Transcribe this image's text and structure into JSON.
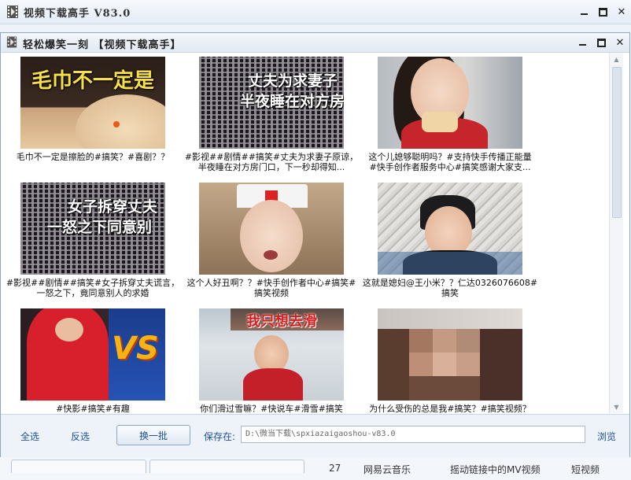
{
  "outer_window": {
    "title": "视频下载高手 V83.0",
    "list_row": {
      "num": "27",
      "col1": "网易云音乐",
      "col2": "摇动链接中的MV视频",
      "col3": "短视频"
    }
  },
  "dialog": {
    "title": "轻松爆笑一刻 【视频下载高手】",
    "videos": [
      {
        "caption_lines": [
          "毛巾不一定是擦脸的#搞笑？#喜剧？？"
        ],
        "overlay": "毛巾不一定是"
      },
      {
        "caption_lines": [
          "#影视##剧情##搞笑#丈夫为求妻子原谅，",
          "半夜睡在对方房门口，下一秒却得知..."
        ],
        "overlay_lines": [
          "丈夫为求妻子",
          "半夜睡在对方房"
        ]
      },
      {
        "caption_lines": [
          "这个儿媳够聪明吗？#支持快手传播正能量",
          "#快手创作者服务中心#搞笑感谢大家支..."
        ]
      },
      {
        "caption_lines": [
          "#影视##剧情##搞笑#女子拆穿丈夫谎言，",
          "一怒之下，竟同意别人的求婚"
        ],
        "overlay_lines": [
          "女子拆穿丈夫",
          "一怒之下同意别"
        ]
      },
      {
        "caption_lines": [
          "这个人好丑啊？？#快手创作者中心#搞笑#",
          "搞笑视频"
        ]
      },
      {
        "caption_lines": [
          "这就是媳妇@王小米？？仁达0326076608#",
          "搞笑"
        ]
      },
      {
        "caption_lines": [
          "#快影#搞笑#有趣"
        ],
        "overlay": "VS"
      },
      {
        "caption_lines": [
          "你们滑过雪嘛？#快说车#滑雪#搞笑"
        ],
        "overlay": "我只想去滑"
      },
      {
        "caption_lines": [
          "为什么受伤的总是我#搞笑？#搞笑视频？"
        ]
      }
    ]
  },
  "toolbar": {
    "select_all": "全选",
    "invert_select": "反选",
    "refresh": "换一批",
    "save_label": "保存在:",
    "save_path": "D:\\微当下载\\spxiazaigaoshou-v83.0",
    "browse": "浏览"
  },
  "icons": {
    "app": "film-strip-icon",
    "minimize": "minimize-icon",
    "maximize": "maximize-icon",
    "close": "close-icon"
  },
  "colors": {
    "link": "#1d4f9a",
    "title_bg": "#e6edf6",
    "toolbar_bg": "#eef3fa"
  }
}
